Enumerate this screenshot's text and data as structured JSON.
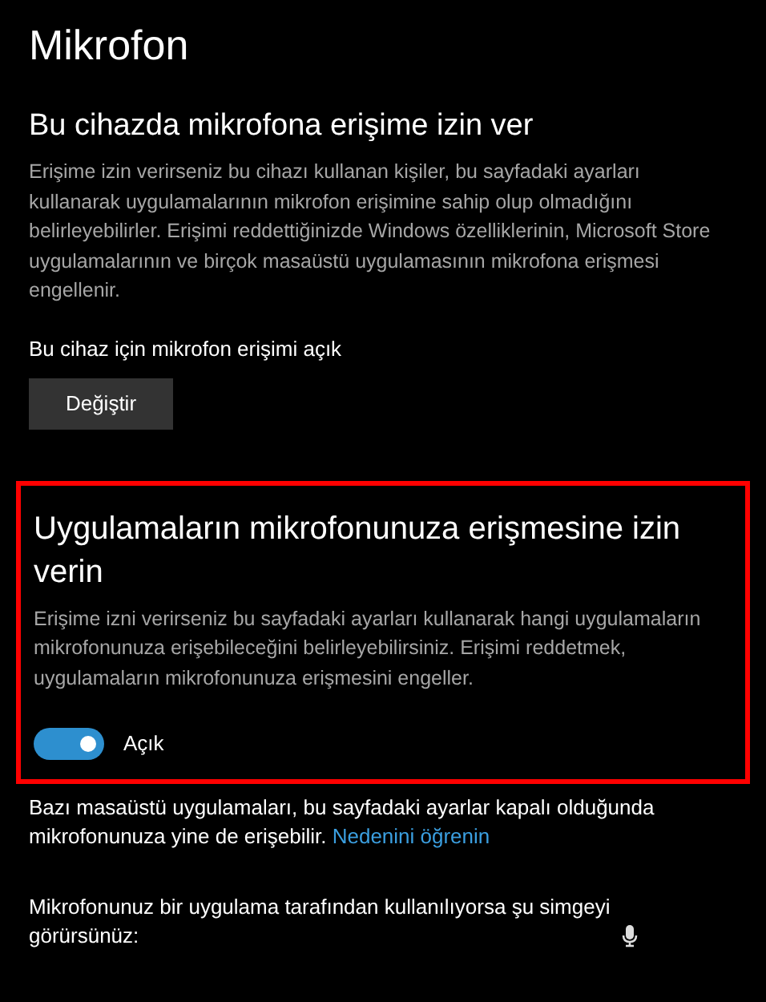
{
  "page_title": "Mikrofon",
  "device_section": {
    "heading": "Bu cihazda mikrofona erişime izin ver",
    "description": "Erişime izin verirseniz bu cihazı kullanan kişiler, bu sayfadaki ayarları kullanarak uygulamalarının mikrofon erişimine sahip olup olmadığını belirleyebilirler. Erişimi reddettiğinizde Windows özelliklerinin, Microsoft Store uygulamalarının ve birçok masaüstü uygulamasının mikrofona erişmesi engellenir.",
    "status": "Bu cihaz için mikrofon erişimi açık",
    "button": "Değiştir"
  },
  "apps_section": {
    "highlighted": true,
    "heading": "Uygulamaların mikrofonunuza erişmesine izin verin",
    "description": "Erişime izni verirseniz bu sayfadaki ayarları kullanarak hangi uygulamaların mikrofonunuza erişebileceğini belirleyebilirsiniz. Erişimi reddetmek, uygulamaların mikrofonunuza erişmesini engeller.",
    "toggle": {
      "on": true,
      "label": "Açık"
    }
  },
  "note": {
    "text": "Bazı masaüstü uygulamaları, bu sayfadaki ayarlar kapalı olduğunda mikrofonunuza yine de erişebilir.",
    "link": "Nedenini öğrenin"
  },
  "icon_note": {
    "text": "Mikrofonunuz bir uygulama tarafından kullanılıyorsa şu simgeyi görürsünüz:"
  }
}
